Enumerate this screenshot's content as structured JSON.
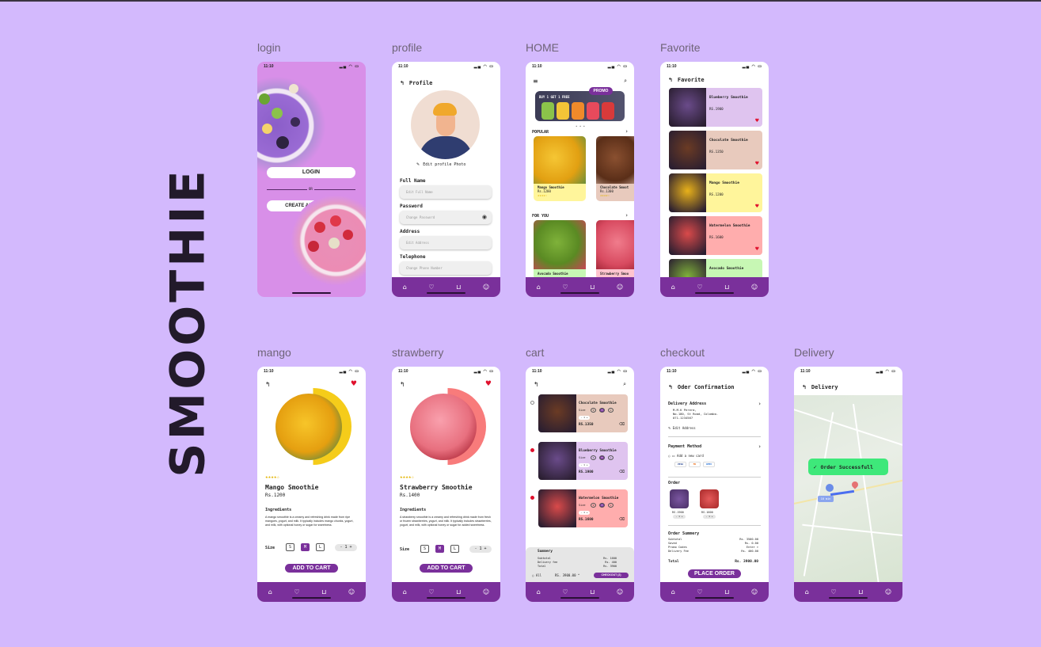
{
  "brand": "SMOOTHIE",
  "colors": {
    "background": "#d3b9fd",
    "accent": "#7a309b",
    "success": "#3ee87a"
  },
  "status_time": "11:10",
  "nav_icons": [
    "home-icon",
    "heart-icon",
    "cart-icon",
    "user-icon"
  ],
  "screens": {
    "login": {
      "label": "login",
      "login_button": "LOGIN",
      "or": "OR",
      "create_button": "CREATE AN ACCOUNT"
    },
    "profile": {
      "label": "profile",
      "title": "Profile",
      "edit_photo": "Edit profile Photo",
      "fields": [
        {
          "label": "Full Name",
          "placeholder": "Edit Full Name"
        },
        {
          "label": "Password",
          "placeholder": "Change Password"
        },
        {
          "label": "Address",
          "placeholder": "Edit Address"
        },
        {
          "label": "Telephone",
          "placeholder": "Change Phone Number"
        }
      ]
    },
    "home": {
      "label": "HOME",
      "promo_badge": "PROMO",
      "banner_text": "BUY 1 GET 1 FREE",
      "popular_title": "POPULAR",
      "for_you_title": "FOR YOU",
      "popular": [
        {
          "name": "Mango Smoothie",
          "price": "Rs.1200",
          "stars": "★★★★☆"
        },
        {
          "name": "Chocolate Smoot",
          "price": "Rs.1300",
          "stars": "★★★★☆"
        }
      ],
      "for_you": [
        {
          "name": "Avocado Smoothie"
        },
        {
          "name": "Strawberry Smoo"
        }
      ]
    },
    "favorite": {
      "label": "Favorite",
      "title": "Favorite",
      "items": [
        {
          "name": "Blueberry Smoothie",
          "price": "RS.1900",
          "bg": "#dfc4ef",
          "img": "#6a4b8a"
        },
        {
          "name": "Chocolate Smoothie",
          "price": "RS.1350",
          "bg": "#e8cabd",
          "img": "#6b3b24"
        },
        {
          "name": "Mango  Smoothie",
          "price": "RS.1200",
          "bg": "#fff59b",
          "img": "#e8b11a"
        },
        {
          "name": "Watermelon Smoothie",
          "price": "RS.1600",
          "bg": "#ffadad",
          "img": "#d94a4a"
        },
        {
          "name": "Avocado Smoothie",
          "price": "",
          "bg": "#c7f7b4",
          "img": "#7fb23a"
        }
      ]
    },
    "mango": {
      "label": "mango",
      "stars": "★★★★☆",
      "name": "Mango Smoothie",
      "price": "Rs.1200",
      "ingredients_title": "Ingredients",
      "description": "A mango smoothie is a creamy and refreshing drink made from ripe mangoes, yogurt, and milk. It typically includes mango chunks, yogurt, and milk, with optional honey or sugar for sweetness.",
      "size_label": "Size",
      "sizes": [
        "S",
        "M",
        "L"
      ],
      "qty": "- 1 +",
      "cta": "ADD TO CART"
    },
    "strawberry": {
      "label": "strawberry",
      "stars": "★★★★☆",
      "name": "Strawberry Smoothie",
      "price": "Rs.1400",
      "ingredients_title": "Ingredients",
      "description": "A strawberry smoothie is a creamy and refreshing drink made from fresh or frozen strawberries, yogurt, and milk. It typically includes strawberries, yogurt, and milk, with optional honey or sugar for added sweetness.",
      "size_label": "Size",
      "sizes": [
        "S",
        "M",
        "L"
      ],
      "qty": "- 1 +",
      "cta": "ADD TO CART"
    },
    "cart": {
      "label": "cart",
      "items": [
        {
          "name": "Chocolate Smoothie",
          "price": "RS.1350",
          "bg": "#e8cabd",
          "img": "#6b3b24"
        },
        {
          "name": "Blueberry Smoothie",
          "price": "RS.1900",
          "bg": "#dfc4ef",
          "img": "#6a4b8a"
        },
        {
          "name": "Watermelon Smoothie",
          "price": "RS.1600",
          "bg": "#ffadad",
          "img": "#d94a4a"
        }
      ],
      "size_label": "Size",
      "sizes": [
        "S",
        "M",
        "L"
      ],
      "qty": "- 1 +",
      "summary_title": "Summery",
      "summary_rows": [
        {
          "k": "Subtotal",
          "v": "Rs. 1600"
        },
        {
          "k": "Delivery fee",
          "v": "Rs.  400"
        },
        {
          "k": "Total",
          "v": "Rs. 3900"
        }
      ],
      "all_label": "All",
      "total": "RS. 3900.00 ^",
      "checkout": "CHECKOUT (2)"
    },
    "checkout": {
      "label": "checkout",
      "title": "Oder Confirmation",
      "delivery_title": "Delivery Address",
      "address_lines": [
        "M.M.K Perera,",
        "No.180, St Road, Colombo.",
        "071-1234567"
      ],
      "edit_address": "Edit Address",
      "payment_title": "Payment Method",
      "add_card": "Add a new card",
      "card_brands": [
        "VISA",
        "MC",
        "AMEX"
      ],
      "order_title": "Order",
      "order_items": [
        {
          "price": "RS.1900",
          "qty": "- 1 +"
        },
        {
          "price": "RS.1600",
          "qty": "- 1 +"
        }
      ],
      "summary_title": "Order Summery",
      "summary_rows": [
        {
          "k": "Subtotal",
          "v": "Rs. 3500.00"
        },
        {
          "k": "Saved",
          "v": "Rs.    0.00"
        },
        {
          "k": "Promo Codes",
          "v": "Enter >"
        },
        {
          "k": "Delivery Fee",
          "v": "Rs.  400.00"
        }
      ],
      "total_label": "Total",
      "total_value": "Rs. 3900.00",
      "cta": "PLACE ORDER"
    },
    "delivery": {
      "label": "Delivery",
      "title": "Delivery",
      "toast": "Order Successfull",
      "eta": "10 min"
    }
  }
}
